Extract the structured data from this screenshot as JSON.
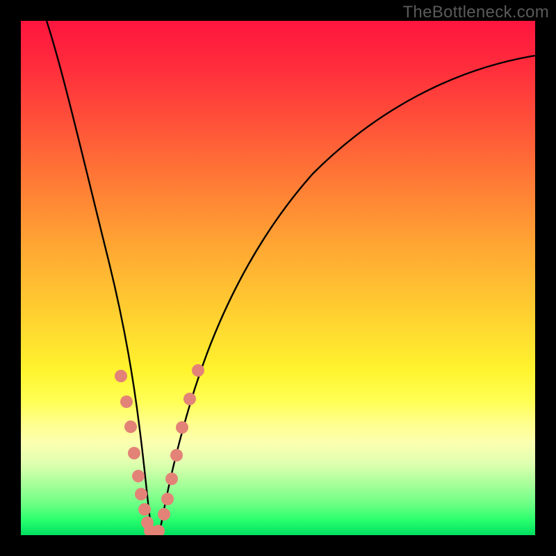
{
  "watermark": "TheBottleneck.com",
  "chart_data": {
    "type": "line",
    "title": "",
    "xlabel": "",
    "ylabel": "",
    "xlim": [
      0,
      100
    ],
    "ylim": [
      0,
      100
    ],
    "background": "gradient-red-to-green",
    "note": "Axes are unlabeled; values are read as percentages of plot area. y=0 at bottom, x=0 at left.",
    "series": [
      {
        "name": "bottleneck-curve",
        "color": "#000000",
        "x": [
          5,
          8,
          12,
          16,
          20,
          22,
          24,
          25,
          26,
          27,
          28,
          32,
          36,
          42,
          50,
          60,
          72,
          86,
          100
        ],
        "y": [
          100,
          86,
          68,
          50,
          28,
          16,
          6,
          1,
          0.5,
          1,
          6,
          22,
          38,
          54,
          66,
          75,
          82,
          87,
          90
        ]
      }
    ],
    "markers": [
      {
        "name": "dots-left-branch",
        "shape": "circle",
        "color": "#e38377",
        "radius_px": 9,
        "x": [
          19.5,
          20.5,
          21.3,
          22.0,
          22.8,
          23.4,
          24.0,
          24.6
        ],
        "y": [
          31.0,
          26.0,
          21.0,
          16.0,
          11.5,
          8.0,
          5.0,
          2.5
        ]
      },
      {
        "name": "dots-bottom",
        "shape": "circle",
        "color": "#e38377",
        "radius_px": 9,
        "x": [
          25.2,
          26.8
        ],
        "y": [
          0.8,
          0.8
        ]
      },
      {
        "name": "dots-right-branch",
        "shape": "circle",
        "color": "#e38377",
        "radius_px": 9,
        "x": [
          27.8,
          28.5,
          29.3,
          30.2,
          31.4,
          32.8,
          34.4
        ],
        "y": [
          4.0,
          7.0,
          11.0,
          15.5,
          21.0,
          26.5,
          32.0
        ]
      }
    ]
  }
}
